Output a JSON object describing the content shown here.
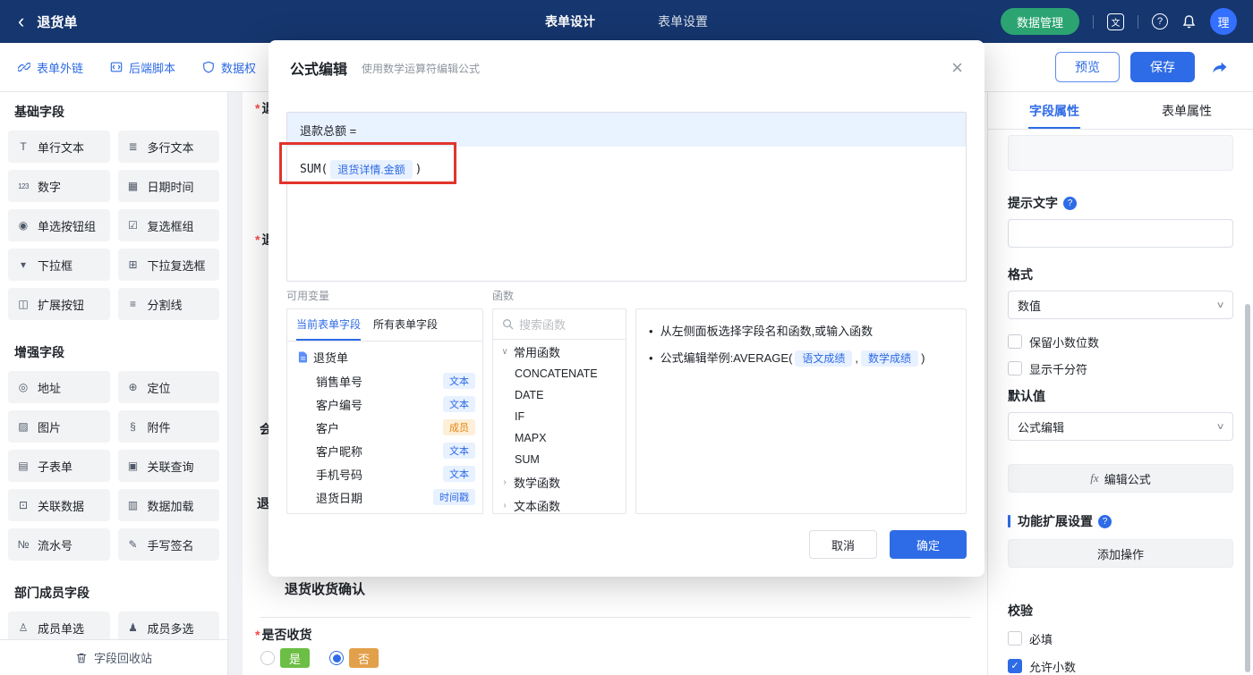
{
  "topbar": {
    "back_icon": "‹",
    "title": "退货单",
    "nav": [
      {
        "label": "表单设计"
      },
      {
        "label": "表单设置"
      }
    ],
    "data_manage_label": "数据管理",
    "lang_icon_text": "文",
    "help_icon_text": "?",
    "avatar_text": "理"
  },
  "toolbar": {
    "links": [
      {
        "label": "表单外链"
      },
      {
        "label": "后端脚本"
      },
      {
        "label": "数据权"
      }
    ],
    "preview_label": "预览",
    "save_label": "保存"
  },
  "sidebar": {
    "sections": [
      {
        "title": "基础字段",
        "items": [
          {
            "icon": "T",
            "label": "单行文本"
          },
          {
            "icon": "≣",
            "label": "多行文本"
          },
          {
            "icon": "123",
            "label": "数字"
          },
          {
            "icon": "▦",
            "label": "日期时间"
          },
          {
            "icon": "◉",
            "label": "单选按钮组"
          },
          {
            "icon": "☑",
            "label": "复选框组"
          },
          {
            "icon": "▾",
            "label": "下拉框"
          },
          {
            "icon": "⊞",
            "label": "下拉复选框"
          },
          {
            "icon": "◫",
            "label": "扩展按钮"
          },
          {
            "icon": "≡",
            "label": "分割线"
          }
        ]
      },
      {
        "title": "增强字段",
        "items": [
          {
            "icon": "◎",
            "label": "地址"
          },
          {
            "icon": "⊕",
            "label": "定位"
          },
          {
            "icon": "▨",
            "label": "图片"
          },
          {
            "icon": "§",
            "label": "附件"
          },
          {
            "icon": "▤",
            "label": "子表单"
          },
          {
            "icon": "▣",
            "label": "关联查询"
          },
          {
            "icon": "⊡",
            "label": "关联数据"
          },
          {
            "icon": "▥",
            "label": "数据加载"
          },
          {
            "icon": "№",
            "label": "流水号"
          },
          {
            "icon": "✎",
            "label": "手写签名"
          }
        ]
      },
      {
        "title": "部门成员字段",
        "items": [
          {
            "icon": "♙",
            "label": "成员单选"
          },
          {
            "icon": "♟",
            "label": "成员多选"
          }
        ]
      }
    ],
    "recycle_label": "字段回收站"
  },
  "canvas": {
    "fragments": [
      {
        "mark": "*",
        "text": "退"
      },
      {
        "mark": "*",
        "text": "退"
      },
      {
        "mark": "",
        "text": "会"
      },
      {
        "mark": "",
        "text": "退"
      }
    ],
    "section_title": "退货收货确认",
    "receive_mark": "*",
    "receive_label": "是否收货",
    "options": [
      {
        "label": "是"
      },
      {
        "label": "否"
      }
    ]
  },
  "modal": {
    "title": "公式编辑",
    "subtitle": "使用数学运算符编辑公式",
    "close_icon": "×",
    "editor": {
      "target": "退款总额 =",
      "func": "SUM(",
      "field_tag": "退货详情.金额",
      "close_paren": ")"
    },
    "variables": {
      "label": "可用变量",
      "tabs": [
        {
          "label": "当前表单字段"
        },
        {
          "label": "所有表单字段"
        }
      ],
      "root": "退货单",
      "fields": [
        {
          "name": "销售单号",
          "type": "文本"
        },
        {
          "name": "客户编号",
          "type": "文本"
        },
        {
          "name": "客户",
          "type": "成员"
        },
        {
          "name": "客户昵称",
          "type": "文本"
        },
        {
          "name": "手机号码",
          "type": "文本"
        },
        {
          "name": "退货日期",
          "type": "时间戳"
        }
      ]
    },
    "functions": {
      "label": "函数",
      "search_placeholder": "搜索函数",
      "groups": [
        {
          "name": "常用函数",
          "chevron": "∨",
          "items": [
            "CONCATENATE",
            "DATE",
            "IF",
            "MAPX",
            "SUM"
          ]
        },
        {
          "name": "数学函数",
          "chevron": "›"
        },
        {
          "name": "文本函数",
          "chevron": "›"
        }
      ]
    },
    "help": {
      "bullet": "•",
      "tip1": "从左侧面板选择字段名和函数,或输入函数",
      "tip2_prefix": "公式编辑举例:AVERAGE(",
      "tip2_tag1": "语文成绩",
      "tip2_comma": ",",
      "tip2_tag2": "数学成绩",
      "tip2_suffix": ")"
    },
    "cancel_label": "取消",
    "ok_label": "确定"
  },
  "panel": {
    "tabs": [
      {
        "label": "字段属性"
      },
      {
        "label": "表单属性"
      }
    ],
    "hint_label": "提示文字",
    "q_icon": "?",
    "format_label": "格式",
    "format_value": "数值",
    "chevron": "∨",
    "keep_decimal_label": "保留小数位数",
    "thousand_label": "显示千分符",
    "default_label": "默认值",
    "default_value": "公式编辑",
    "fx": "fx",
    "edit_formula_label": "编辑公式",
    "ext_label": "功能扩展设置",
    "add_action_label": "添加操作",
    "validate_label": "校验",
    "required_label": "必填",
    "allow_decimal_label": "允许小数"
  }
}
